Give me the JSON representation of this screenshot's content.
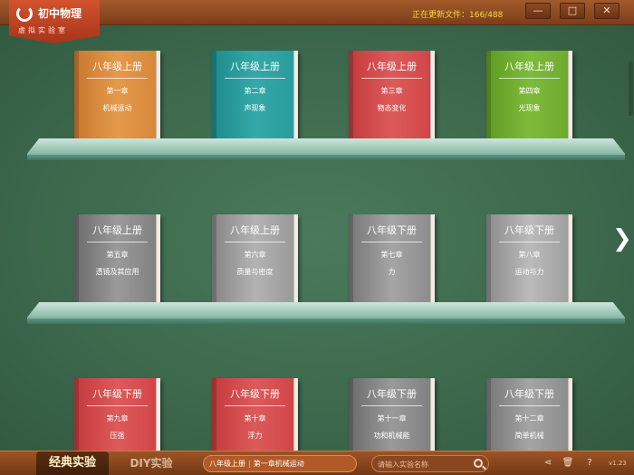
{
  "app": {
    "title": "初中物理",
    "subtitle": "虚拟实验室"
  },
  "status": {
    "update_text": "正在更新文件：166/488"
  },
  "window": {
    "minimize": "—",
    "maximize": "□",
    "close": "✕"
  },
  "shelves": [
    [
      {
        "grade": "八年级上册",
        "chapter": "第一章",
        "name": "机械运动",
        "color": "orange"
      },
      {
        "grade": "八年级上册",
        "chapter": "第二章",
        "name": "声现象",
        "color": "teal"
      },
      {
        "grade": "八年级上册",
        "chapter": "第三章",
        "name": "物态变化",
        "color": "red"
      },
      {
        "grade": "八年级上册",
        "chapter": "第四章",
        "name": "光现象",
        "color": "green"
      }
    ],
    [
      {
        "grade": "八年级上册",
        "chapter": "第五章",
        "name": "透镜及其应用",
        "color": "gray1"
      },
      {
        "grade": "八年级上册",
        "chapter": "第六章",
        "name": "质量与密度",
        "color": "gray2"
      },
      {
        "grade": "八年级下册",
        "chapter": "第七章",
        "name": "力",
        "color": "gray3"
      },
      {
        "grade": "八年级下册",
        "chapter": "第八章",
        "name": "运动与力",
        "color": "gray4"
      }
    ],
    [
      {
        "grade": "八年级下册",
        "chapter": "第九章",
        "name": "压强",
        "color": "red"
      },
      {
        "grade": "八年级下册",
        "chapter": "第十章",
        "name": "浮力",
        "color": "red"
      },
      {
        "grade": "八年级下册",
        "chapter": "第十一章",
        "name": "功和机械能",
        "color": "gray1"
      },
      {
        "grade": "八年级下册",
        "chapter": "第十二章",
        "name": "简单机械",
        "color": "gray3"
      }
    ]
  ],
  "nav": {
    "next_icon": "chevron-right-icon",
    "next_glyph": "❯"
  },
  "bottom": {
    "tab_classic": "经典实验",
    "tab_diy": "DIY实验",
    "breadcrumb_grade": "八年级上册",
    "breadcrumb_chapter": "第一章机械运动",
    "search_placeholder": "请输入实验名称",
    "share_glyph": "⋖",
    "delete_glyph": "🗑",
    "help_glyph": "?",
    "version": "v1.23"
  }
}
